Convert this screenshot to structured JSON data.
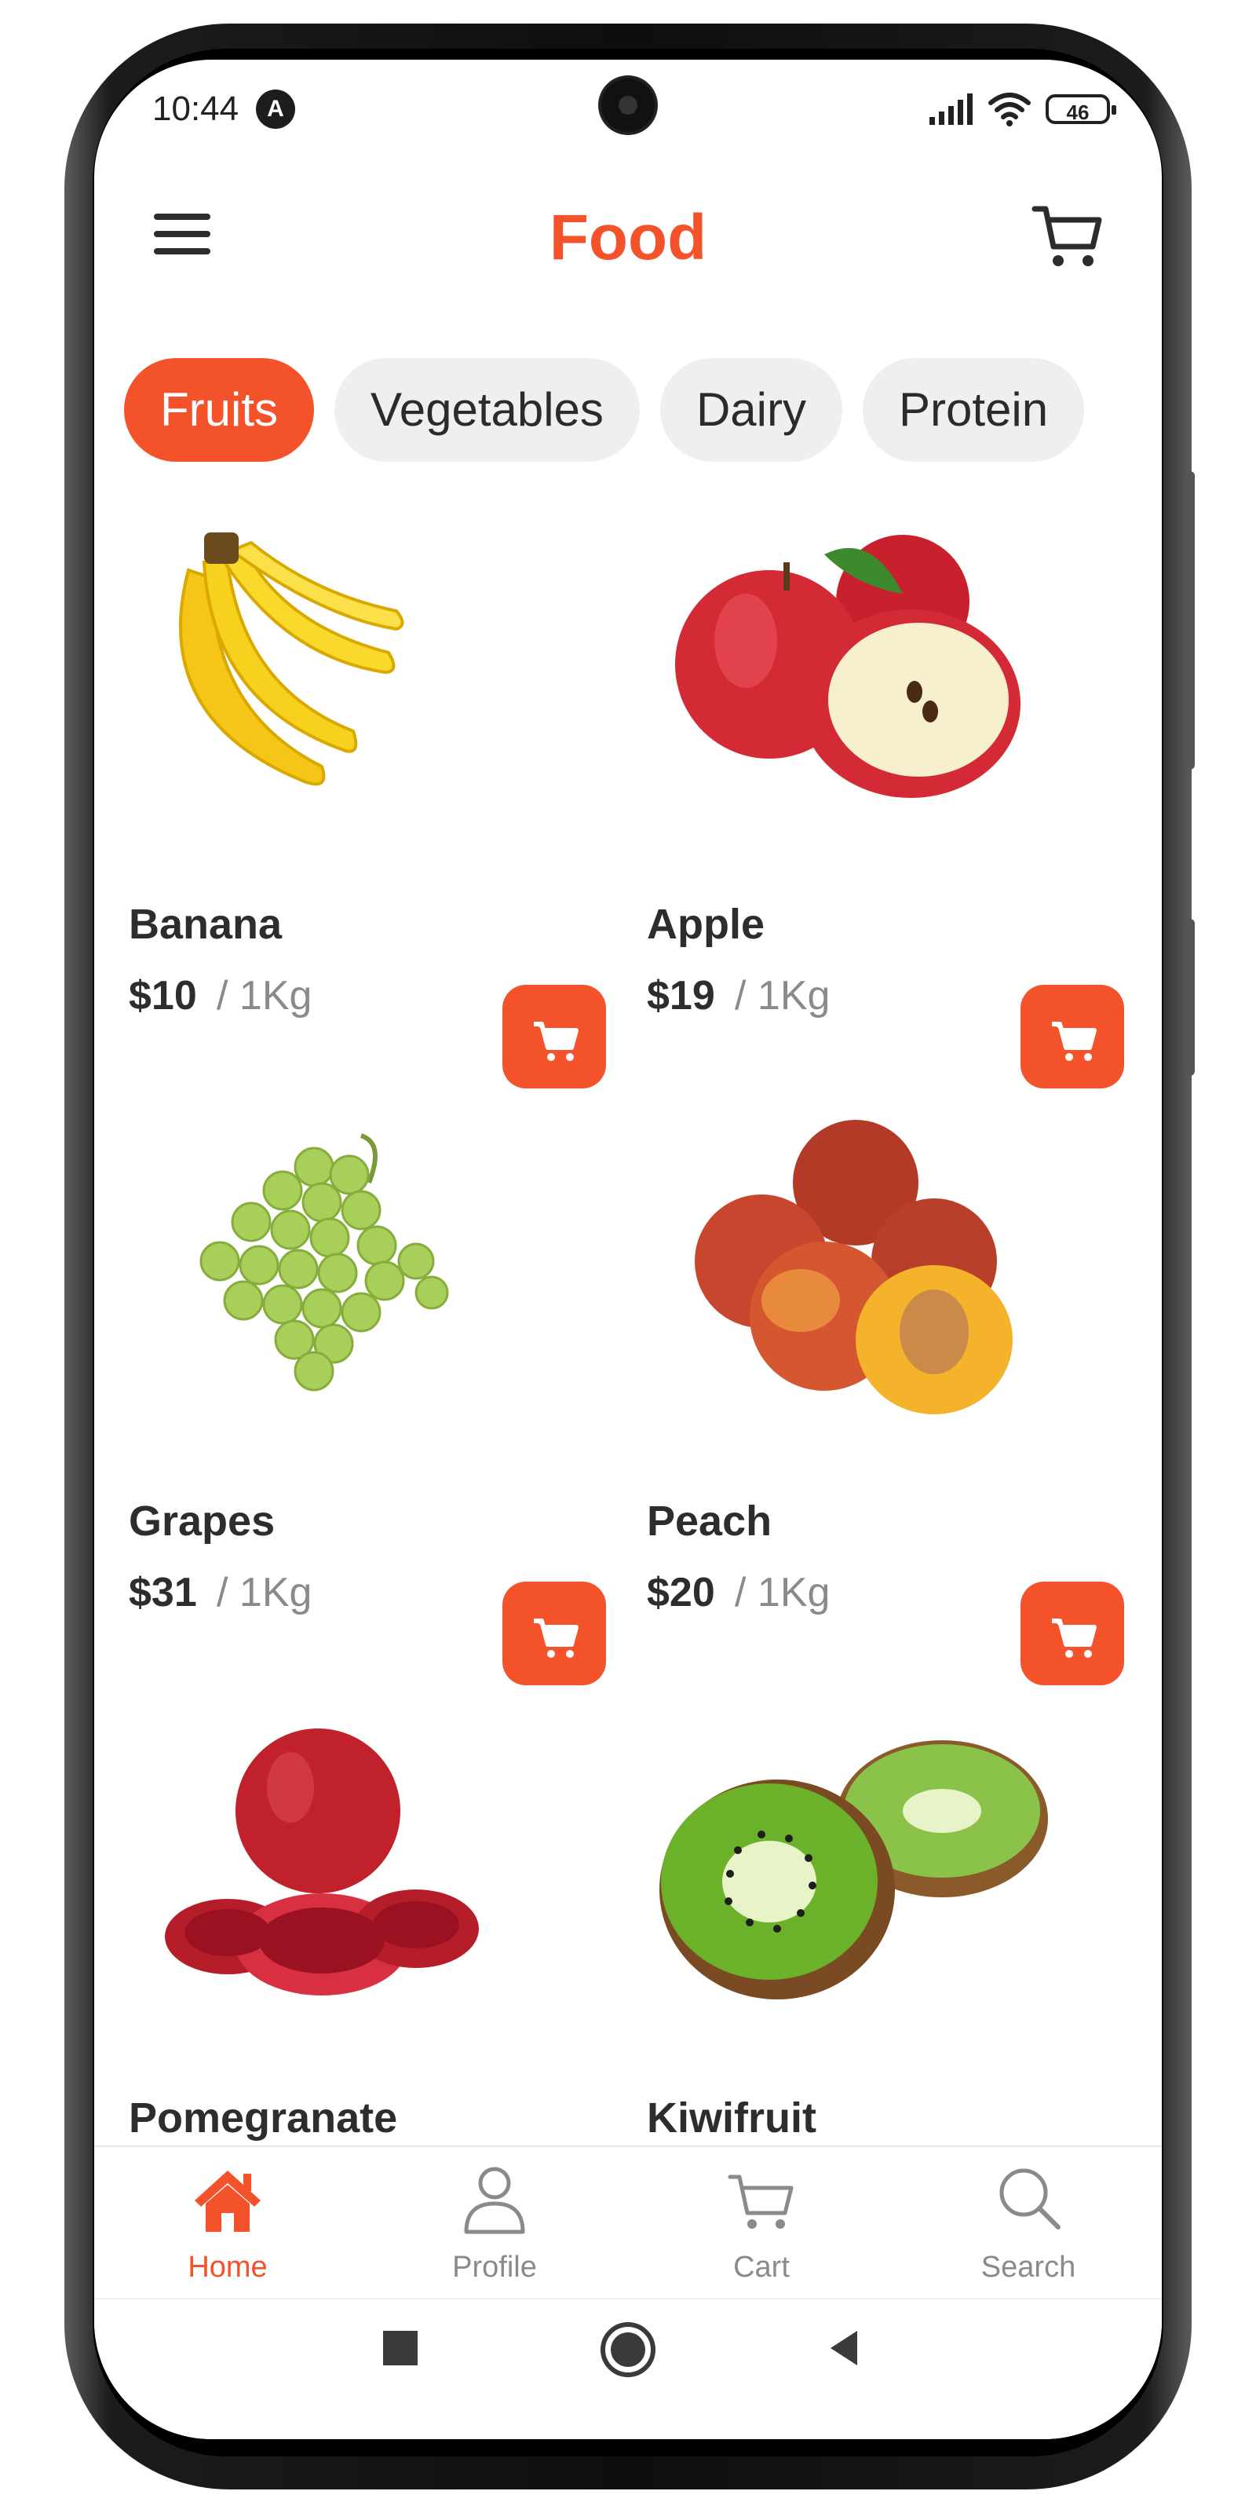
{
  "status_bar": {
    "time": "10:44",
    "notification_badge": "A",
    "battery": "46"
  },
  "header": {
    "title": "Food"
  },
  "categories": [
    {
      "label": "Fruits",
      "active": true
    },
    {
      "label": "Vegetables",
      "active": false
    },
    {
      "label": "Dairy",
      "active": false
    },
    {
      "label": "Protein",
      "active": false
    }
  ],
  "products": [
    {
      "name": "Banana",
      "price": "$10",
      "unit": "/ 1Kg",
      "icon": "banana-image"
    },
    {
      "name": "Apple",
      "price": "$19",
      "unit": "/ 1Kg",
      "icon": "apple-image"
    },
    {
      "name": "Grapes",
      "price": "$31",
      "unit": "/ 1Kg",
      "icon": "grapes-image"
    },
    {
      "name": "Peach",
      "price": "$20",
      "unit": "/ 1Kg",
      "icon": "peach-image"
    },
    {
      "name": "Pomegranate",
      "icon": "pomegranate-image"
    },
    {
      "name": "Kiwifruit",
      "icon": "kiwi-image"
    }
  ],
  "bottom_nav": [
    {
      "label": "Home",
      "icon": "home-icon",
      "active": true
    },
    {
      "label": "Profile",
      "icon": "profile-icon",
      "active": false
    },
    {
      "label": "Cart",
      "icon": "cart-icon",
      "active": false
    },
    {
      "label": "Search",
      "icon": "search-icon",
      "active": false
    }
  ],
  "colors": {
    "accent": "#f4522a",
    "chip_bg": "#efefef",
    "text": "#2d2d2d",
    "muted": "#8a8a8a"
  }
}
